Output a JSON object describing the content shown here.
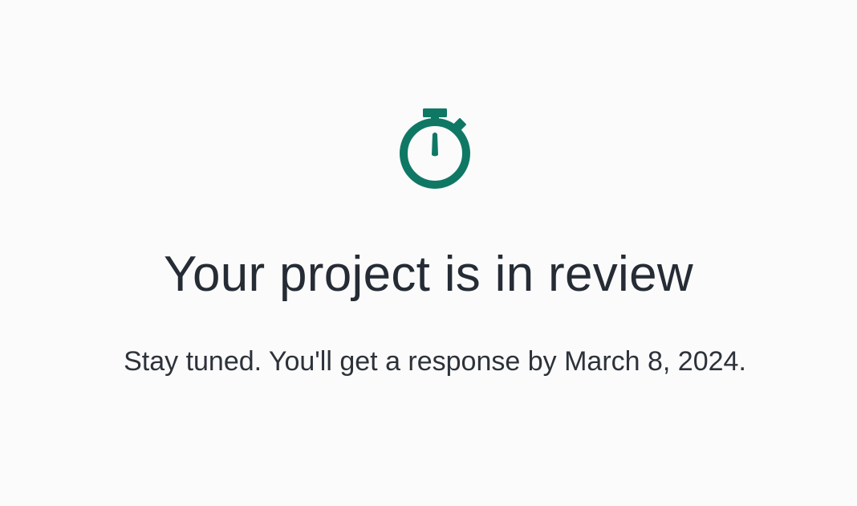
{
  "page": {
    "icon": "stopwatch-icon",
    "title": "Your project is in review",
    "message": "Stay tuned. You'll get a response by March 8, 2024."
  },
  "colors": {
    "accent": "#0f7865",
    "text": "#262c35",
    "background": "#fbfbfb"
  }
}
